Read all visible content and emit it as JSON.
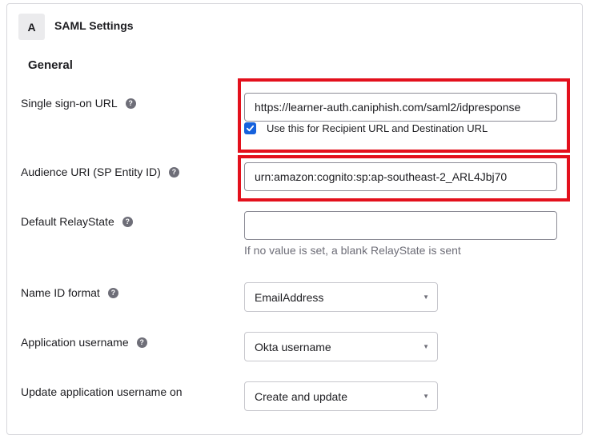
{
  "panel": {
    "badge": "A",
    "title": "SAML Settings",
    "section": "General"
  },
  "fields": {
    "sso_url": {
      "label": "Single sign-on URL",
      "value": "https://learner-auth.caniphish.com/saml2/idpresponse",
      "checkbox_label": "Use this for Recipient URL and Destination URL",
      "checkbox_checked": true
    },
    "audience_uri": {
      "label": "Audience URI (SP Entity ID)",
      "value": "urn:amazon:cognito:sp:ap-southeast-2_ARL4Jbj70"
    },
    "relay_state": {
      "label": "Default RelayState",
      "value": "",
      "hint": "If no value is set, a blank RelayState is sent"
    },
    "name_id_format": {
      "label": "Name ID format",
      "selected": "EmailAddress"
    },
    "app_username": {
      "label": "Application username",
      "selected": "Okta username"
    },
    "update_username": {
      "label": "Update application username on",
      "selected": "Create and update"
    }
  },
  "icons": {
    "help": "question-mark-icon",
    "checkmark": "checkmark-icon",
    "caret": "caret-down-icon"
  },
  "colors": {
    "accent": "#1662dd",
    "highlight": "#e3101c",
    "help_icon": "#6e6e78"
  }
}
